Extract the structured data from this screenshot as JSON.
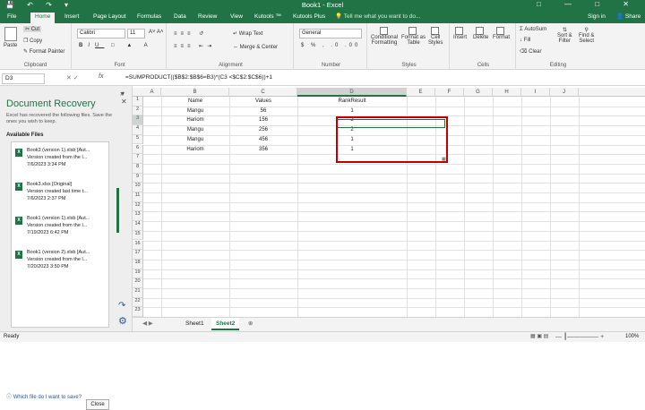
{
  "window": {
    "title": "Book1 - Excel",
    "signin": "Sign in",
    "share": "Share"
  },
  "tabs": [
    "File",
    "Home",
    "Insert",
    "Page Layout",
    "Formulas",
    "Data",
    "Review",
    "View",
    "Kutools ™",
    "Kutools Plus"
  ],
  "tellme": "Tell me what you want to do...",
  "ribbon": {
    "paste": "Paste",
    "cut": "Cut",
    "copy": "Copy",
    "format_painter": "Format Painter",
    "clipboard": "Clipboard",
    "font_name": "Calibri",
    "font_size": "11",
    "font": "Font",
    "wrap_text": "Wrap Text",
    "merge_center": "Merge & Center",
    "alignment": "Alignment",
    "number_format": "General",
    "number": "Number",
    "cond_formatting": "Conditional",
    "cond_formatting2": "Formatting",
    "format_as_table": "Format as",
    "format_as_table2": "Table",
    "cell_styles": "Cell",
    "cell_styles2": "Styles",
    "styles": "Styles",
    "insert": "Insert",
    "delete": "Delete",
    "format": "Format",
    "cells": "Cells",
    "autosum": "AutoSum",
    "fill": "Fill",
    "clear": "Clear",
    "sort_filter": "Sort &",
    "sort_filter2": "Filter",
    "find_select": "Find &",
    "find_select2": "Select",
    "editing": "Editing"
  },
  "formula_bar": {
    "name_box": "D3",
    "formula": "=SUMPRODUCT(($B$2:$B$6=B3)*(C3 <$C$2:$C$6))+1"
  },
  "recovery": {
    "title": "Document Recovery",
    "desc": "Excel has recovered the following files. Save the ones you wish to keep.",
    "available": "Available Files",
    "files": [
      {
        "name": "Book3 (version 1).xlsb  [Aut...",
        "line2": "Version created from the l...",
        "date": "7/6/2023 3:34 PM"
      },
      {
        "name": "Book3.xlsx  [Original]",
        "line2": "Version created last time t...",
        "date": "7/6/2023 2:37 PM"
      },
      {
        "name": "Book1 (version 1).xlsb  [Aut...",
        "line2": "Version created from the l...",
        "date": "7/19/2023 6:42 PM"
      },
      {
        "name": "Book1 (version 2).xlsb  [Aut...",
        "line2": "Version created from the l...",
        "date": "7/20/2023 3:50 PM"
      }
    ],
    "help": "Which file do I want to save?",
    "close": "Close"
  },
  "columns": [
    "A",
    "B",
    "C",
    "D",
    "E",
    "F",
    "G",
    "H",
    "I",
    "J"
  ],
  "rows": [
    "1",
    "2",
    "3",
    "4",
    "5",
    "6",
    "7",
    "8",
    "9",
    "10",
    "11",
    "12",
    "13",
    "14",
    "15",
    "16",
    "17",
    "18",
    "19",
    "20",
    "21",
    "22",
    "23"
  ],
  "table": {
    "headers": [
      "Name",
      "Values",
      "RankResult"
    ],
    "data": [
      [
        "Mangu",
        "56",
        "1"
      ],
      [
        "Hariom",
        "156",
        "2"
      ],
      [
        "Mangu",
        "256",
        "2"
      ],
      [
        "Mangu",
        "456",
        "1"
      ],
      [
        "Hariom",
        "356",
        "1"
      ]
    ]
  },
  "sheets": [
    "Sheet1",
    "Sheet2"
  ],
  "status": {
    "ready": "Ready",
    "zoom": "100%"
  }
}
